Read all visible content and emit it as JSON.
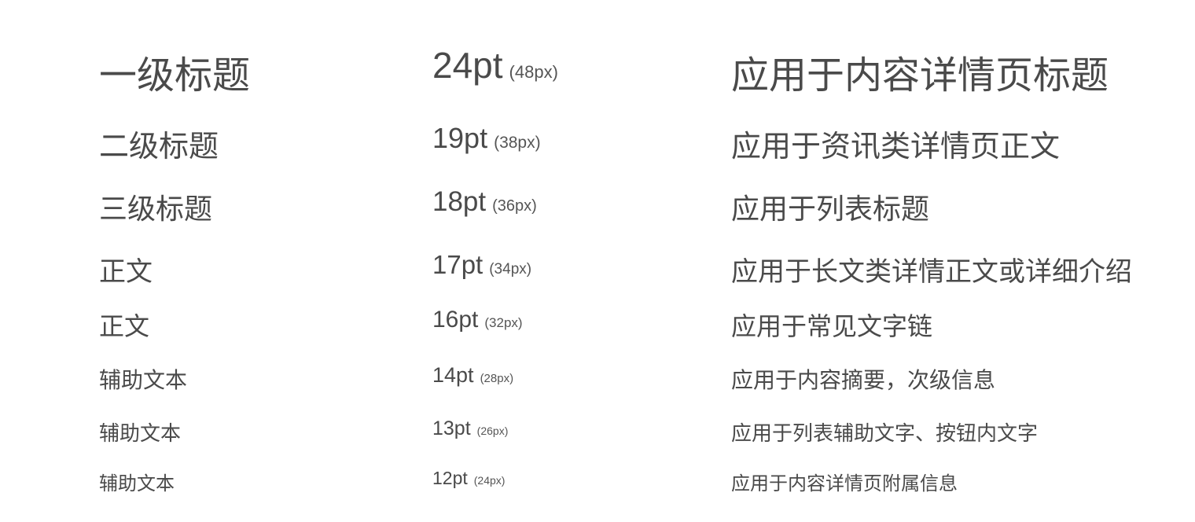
{
  "rows": [
    {
      "name": "一级标题",
      "pt": "24pt",
      "px": "(48px)",
      "usage": "应用于内容详情页标题"
    },
    {
      "name": "二级标题",
      "pt": "19pt",
      "px": "(38px)",
      "usage": "应用于资讯类详情页正文"
    },
    {
      "name": "三级标题",
      "pt": "18pt",
      "px": "(36px)",
      "usage": "应用于列表标题"
    },
    {
      "name": "正文",
      "pt": "17pt",
      "px": "(34px)",
      "usage": "应用于长文类详情正文或详细介绍"
    },
    {
      "name": "正文",
      "pt": "16pt",
      "px": "(32px)",
      "usage": "应用于常见文字链"
    },
    {
      "name": "辅助文本",
      "pt": "14pt",
      "px": "(28px)",
      "usage": "应用于内容摘要，次级信息"
    },
    {
      "name": "辅助文本",
      "pt": "13pt",
      "px": "(26px)",
      "usage": "应用于列表辅助文字、按钮内文字"
    },
    {
      "name": "辅助文本",
      "pt": "12pt",
      "px": "(24px)",
      "usage": "应用于内容详情页附属信息"
    }
  ],
  "colors": {
    "text": "#4a4a4a",
    "background": "#ffffff"
  }
}
